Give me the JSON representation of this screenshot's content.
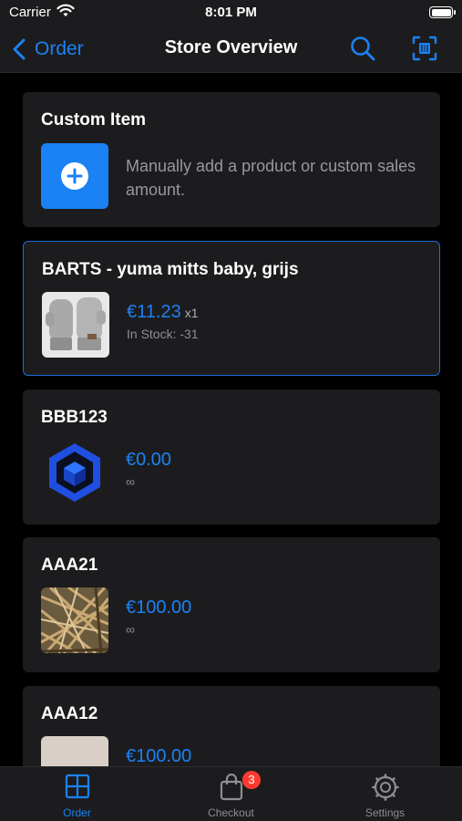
{
  "status_bar": {
    "carrier": "Carrier",
    "time": "8:01 PM"
  },
  "nav": {
    "back_label": "Order",
    "title": "Store Overview"
  },
  "custom_item": {
    "title": "Custom Item",
    "description": "Manually add a product or custom sales amount."
  },
  "products": [
    {
      "name": "BARTS - yuma mitts baby, grijs",
      "price": "€11.23",
      "quantity": "x1",
      "stock": "In Stock: -31",
      "selected": true
    },
    {
      "name": "BBB123",
      "price": "€0.00",
      "stock": "∞"
    },
    {
      "name": "AAA21",
      "price": "€100.00",
      "stock": "∞"
    },
    {
      "name": "AAA12",
      "price": "€100.00"
    }
  ],
  "tabs": [
    {
      "label": "Order",
      "icon": "grid-icon",
      "active": true
    },
    {
      "label": "Checkout",
      "icon": "bag-icon",
      "badge": "3"
    },
    {
      "label": "Settings",
      "icon": "gear-icon"
    }
  ],
  "colors": {
    "accent": "#1a82f5",
    "badge": "#ff3b30",
    "card": "#1c1c1e",
    "background": "#000000"
  }
}
